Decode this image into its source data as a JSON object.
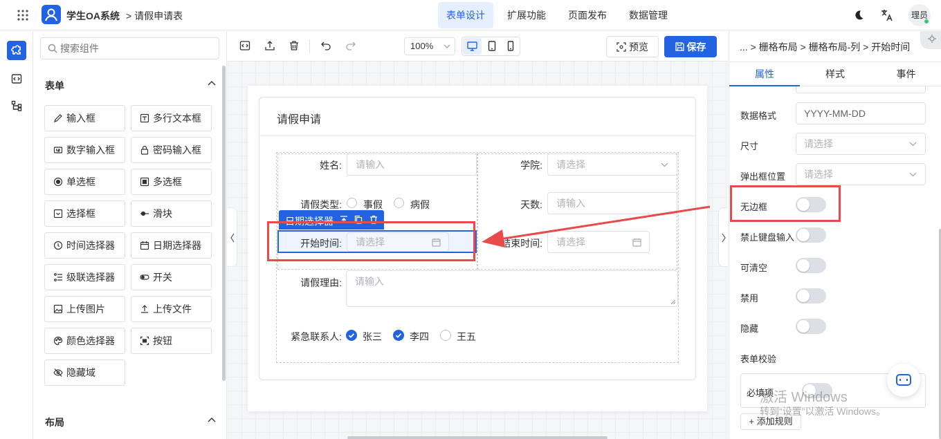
{
  "app": {
    "logo_text": "学生OA系统",
    "breadcrumb": "> 请假申请表",
    "nav": [
      "表单设计",
      "扩展功能",
      "页面发布",
      "数据管理"
    ],
    "user": "理员"
  },
  "components": {
    "search_placeholder": "搜索组件",
    "section_form": "表单",
    "section_layout": "布局",
    "items": [
      {
        "label": "输入框",
        "icon": "pencil-icon"
      },
      {
        "label": "多行文本框",
        "icon": "textarea-icon"
      },
      {
        "label": "数字输入框",
        "icon": "number-icon"
      },
      {
        "label": "密码输入框",
        "icon": "lock-icon"
      },
      {
        "label": "单选框",
        "icon": "radio-icon"
      },
      {
        "label": "多选框",
        "icon": "checkbox-icon"
      },
      {
        "label": "选择框",
        "icon": "select-icon"
      },
      {
        "label": "滑块",
        "icon": "slider-icon"
      },
      {
        "label": "时间选择器",
        "icon": "clock-icon"
      },
      {
        "label": "日期选择器",
        "icon": "calendar-icon"
      },
      {
        "label": "级联选择器",
        "icon": "cascader-icon"
      },
      {
        "label": "开关",
        "icon": "toggle-icon"
      },
      {
        "label": "上传图片",
        "icon": "image-icon"
      },
      {
        "label": "上传文件",
        "icon": "upload-icon"
      },
      {
        "label": "颜色选择器",
        "icon": "palette-icon"
      },
      {
        "label": "按钮",
        "icon": "button-icon"
      },
      {
        "label": "隐藏域",
        "icon": "eye-off-icon"
      }
    ]
  },
  "toolbar": {
    "zoom": "100%",
    "preview": "预览",
    "save": "保存"
  },
  "form": {
    "title": "请假申请",
    "name_label": "姓名:",
    "name_placeholder": "请输入",
    "college_label": "学院:",
    "college_placeholder": "请选择",
    "leave_type_label": "请假类型:",
    "leave_options": [
      "事假",
      "病假"
    ],
    "days_label": "天数:",
    "days_placeholder": "请输入",
    "selected_tag": "日期选择器",
    "start_label": "开始时间:",
    "start_placeholder": "请选择",
    "end_label": "结束时间:",
    "end_placeholder": "请选择",
    "reason_label": "请假理由:",
    "reason_placeholder": "请输入",
    "contact_label": "紧急联系人:",
    "contacts": [
      {
        "name": "张三",
        "checked": true
      },
      {
        "name": "李四",
        "checked": true
      },
      {
        "name": "王五",
        "checked": false
      }
    ]
  },
  "props": {
    "breadcrumb": "... > 栅格布局 > 栅格布局-列 > 开始时间",
    "tabs": [
      "属性",
      "样式",
      "事件"
    ],
    "data_format_label": "数据格式",
    "data_format_value": "YYYY-MM-DD",
    "size_label": "尺寸",
    "size_placeholder": "请选择",
    "popup_label": "弹出框位置",
    "popup_placeholder": "请选择",
    "borderless_label": "无边框",
    "no_keyboard_label": "禁止键盘输入",
    "clearable_label": "可清空",
    "disabled_label": "禁用",
    "hidden_label": "隐藏",
    "validation_label": "表单校验",
    "required_label": "必填项",
    "add_rule": "+ 添加规则"
  },
  "watermark": {
    "line1": "激活 Windows",
    "line2": "转到“设置”以激活 Windows。"
  },
  "colors": {
    "primary": "#2163e0",
    "highlight_red": "#e94a4a"
  }
}
